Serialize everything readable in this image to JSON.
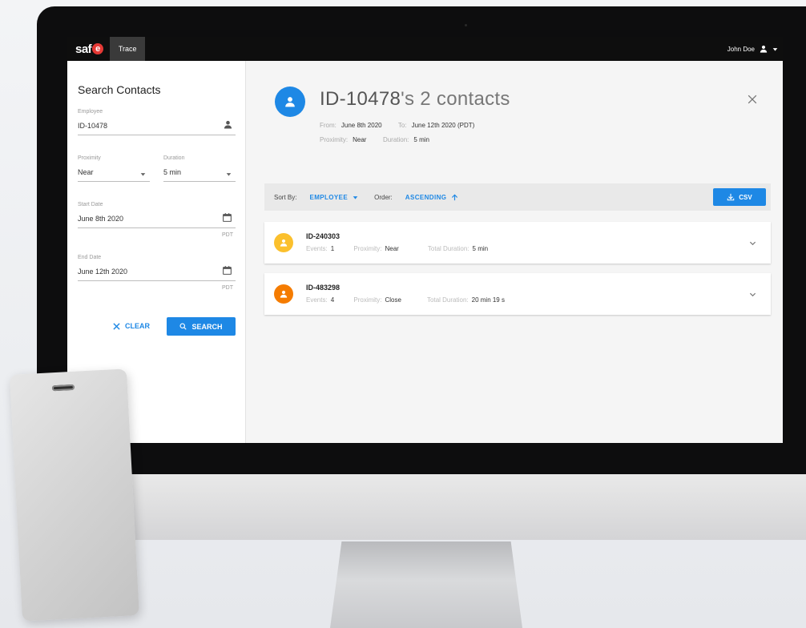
{
  "header": {
    "logo_text": "saf",
    "logo_accent": "e",
    "tab_label": "Trace",
    "user_name": "John Doe"
  },
  "search": {
    "title": "Search Contacts",
    "employee_label": "Employee",
    "employee_value": "ID-10478",
    "proximity_label": "Proximity",
    "proximity_value": "Near",
    "duration_label": "Duration",
    "duration_value": "5 min",
    "start_label": "Start Date",
    "start_value": "June 8th 2020",
    "end_label": "End Date",
    "end_value": "June 12th 2020",
    "tz": "PDT",
    "clear_label": "CLEAR",
    "search_label": "SEARCH"
  },
  "result": {
    "title_id": "ID-10478",
    "title_rest": "'s 2 contacts",
    "from_label": "From:",
    "from_value": "June 8th 2020",
    "to_label": "To:",
    "to_value": "June 12th 2020 (PDT)",
    "proximity_label": "Proximity:",
    "proximity_value": "Near",
    "duration_label": "Duration:",
    "duration_value": "5 min"
  },
  "sortbar": {
    "sort_label": "Sort By:",
    "sort_value": "EMPLOYEE",
    "order_label": "Order:",
    "order_value": "ASCENDING",
    "csv_label": "CSV"
  },
  "contacts": [
    {
      "id": "ID-240303",
      "events_label": "Events:",
      "events": "1",
      "proximity_label": "Proximity:",
      "proximity": "Near",
      "duration_label": "Total Duration:",
      "duration": "5 min",
      "color": "#fbc02d"
    },
    {
      "id": "ID-483298",
      "events_label": "Events:",
      "events": "4",
      "proximity_label": "Proximity:",
      "proximity": "Close",
      "duration_label": "Total Duration:",
      "duration": "20 min 19 s",
      "color": "#f57c00"
    }
  ],
  "colors": {
    "accent": "#1e88e5",
    "topbar": "#0e0e0e"
  },
  "icons": [
    "person-icon",
    "chevron-down-icon",
    "calendar-icon",
    "close-icon",
    "search-icon",
    "arrow-up-icon",
    "download-icon"
  ]
}
